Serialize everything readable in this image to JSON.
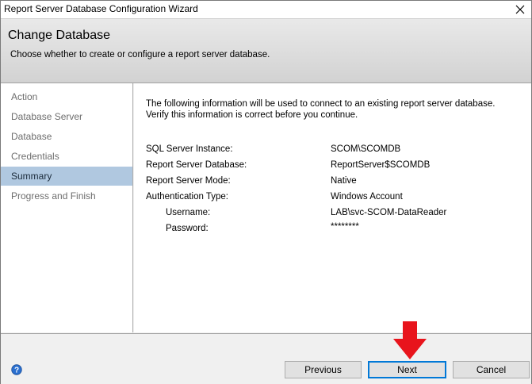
{
  "window": {
    "title": "Report Server Database Configuration Wizard"
  },
  "header": {
    "title": "Change Database",
    "subtitle": "Choose whether to create or configure a report server database."
  },
  "nav": {
    "items": [
      {
        "label": "Action"
      },
      {
        "label": "Database Server"
      },
      {
        "label": "Database"
      },
      {
        "label": "Credentials"
      },
      {
        "label": "Summary",
        "selected": true
      },
      {
        "label": "Progress and Finish"
      }
    ]
  },
  "content": {
    "intro_line1": "The following information will be used to connect to an existing report server database.",
    "intro_line2": "Verify this information is correct before you continue.",
    "fields": [
      {
        "label": "SQL Server Instance:",
        "value": "SCOM\\SCOMDB"
      },
      {
        "label": "Report Server Database:",
        "value": "ReportServer$SCOMDB"
      },
      {
        "label": "Report Server Mode:",
        "value": "Native"
      },
      {
        "label": "Authentication Type:",
        "value": "Windows Account"
      },
      {
        "label": "Username:",
        "value": "LAB\\svc-SCOM-DataReader"
      },
      {
        "label": "Password:",
        "value": "********"
      }
    ]
  },
  "footer": {
    "previous_label": "Previous",
    "next_label": "Next",
    "cancel_label": "Cancel"
  },
  "colors": {
    "selected_nav": "#b0c8e0",
    "accent": "#0078d7",
    "arrow": "#e8141c"
  },
  "icons": [
    "close-icon",
    "help-icon",
    "red-down-arrow-icon"
  ]
}
